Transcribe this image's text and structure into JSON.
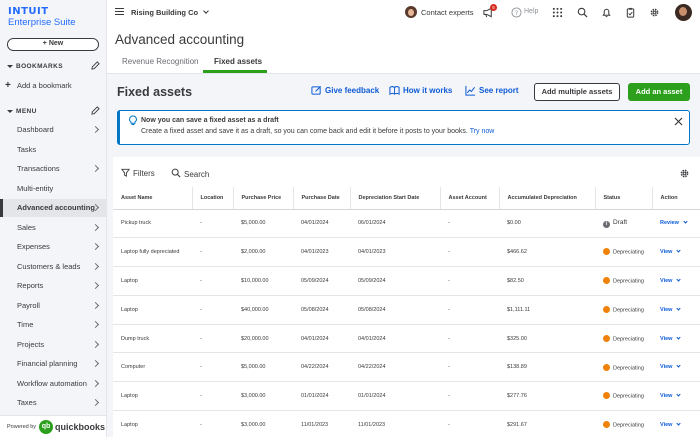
{
  "brand": {
    "logo_top": "INTUIT",
    "logo_bottom": "Enterprise Suite",
    "powered_by": "Powered by",
    "quickbooks": "quickbooks"
  },
  "sidebar": {
    "new_label": "+ New",
    "bookmarks_header": "BOOKMARKS",
    "add_bookmark": "Add a bookmark",
    "menu_header": "MENU",
    "items": [
      {
        "label": "Dashboard",
        "chevron": true,
        "active": false
      },
      {
        "label": "Tasks",
        "chevron": false,
        "active": false
      },
      {
        "label": "Transactions",
        "chevron": true,
        "active": false
      },
      {
        "label": "Multi-entity",
        "chevron": false,
        "active": false
      },
      {
        "label": "Advanced accounting",
        "chevron": true,
        "active": true
      },
      {
        "label": "Sales",
        "chevron": true,
        "active": false
      },
      {
        "label": "Expenses",
        "chevron": true,
        "active": false
      },
      {
        "label": "Customers & leads",
        "chevron": true,
        "active": false
      },
      {
        "label": "Reports",
        "chevron": true,
        "active": false
      },
      {
        "label": "Payroll",
        "chevron": true,
        "active": false
      },
      {
        "label": "Time",
        "chevron": true,
        "active": false
      },
      {
        "label": "Projects",
        "chevron": true,
        "active": false
      },
      {
        "label": "Financial planning",
        "chevron": true,
        "active": false
      },
      {
        "label": "Workflow automation",
        "chevron": true,
        "active": false
      },
      {
        "label": "Taxes",
        "chevron": true,
        "active": false
      }
    ]
  },
  "topbar": {
    "company": "Rising Building Co",
    "contact": "Contact experts",
    "help": "Help",
    "notification_count": "5"
  },
  "page": {
    "title": "Advanced accounting",
    "tabs": [
      {
        "label": "Revenue Recognition",
        "active": false
      },
      {
        "label": "Fixed assets",
        "active": true
      }
    ],
    "section_title": "Fixed assets",
    "links": {
      "feedback": "Give feedback",
      "how": "How it works",
      "report": "See report"
    },
    "add_multiple": "Add multiple assets",
    "add_asset": "Add an asset"
  },
  "info": {
    "title": "Now you can save a fixed asset as a draft",
    "body": "Create a fixed asset and save it as a draft, so you can come back and edit it before it posts to your books.",
    "link": "Try now"
  },
  "toolbar": {
    "filters": "Filters",
    "search": "Search"
  },
  "table": {
    "columns": [
      "Asset Name",
      "Location",
      "Purchase Price",
      "Purchase Date",
      "Depreciation Start Date",
      "Asset Account",
      "Accumulated Depreciation",
      "Status",
      "Action"
    ],
    "rows": [
      [
        "Pickup truck",
        "-",
        "$5,000.00",
        "04/01/2024",
        "06/01/2024",
        "-",
        "$0.00",
        "Draft",
        "Review"
      ],
      [
        "Laptop fully depreciated",
        "-",
        "$2,000.00",
        "04/01/2023",
        "04/01/2023",
        "-",
        "$466.62",
        "Depreciating",
        "View"
      ],
      [
        "Laptop",
        "-",
        "$10,000.00",
        "05/09/2024",
        "05/09/2024",
        "-",
        "$82.50",
        "Depreciating",
        "View"
      ],
      [
        "Laptop",
        "-",
        "$40,000.00",
        "05/08/2024",
        "05/08/2024",
        "-",
        "$1,111.11",
        "Depreciating",
        "View"
      ],
      [
        "Dump truck",
        "-",
        "$20,000.00",
        "04/01/2024",
        "04/01/2024",
        "-",
        "$325.00",
        "Depreciating",
        "View"
      ],
      [
        "Computer",
        "-",
        "$5,000.00",
        "04/22/2024",
        "04/22/2024",
        "-",
        "$138.89",
        "Depreciating",
        "View"
      ],
      [
        "Laptop",
        "-",
        "$3,000.00",
        "01/01/2024",
        "01/01/2024",
        "-",
        "$277.76",
        "Depreciating",
        "View"
      ],
      [
        "Laptop",
        "-",
        "$3,000.00",
        "11/01/2023",
        "11/01/2023",
        "-",
        "$291.67",
        "Depreciating",
        "View"
      ]
    ]
  },
  "colors": {
    "brand_green": "#2ca01c",
    "intuit_blue": "#236cff",
    "link_blue": "#0d5bd6",
    "depreciating": "#f0820a",
    "draft": "#6b6c72"
  }
}
